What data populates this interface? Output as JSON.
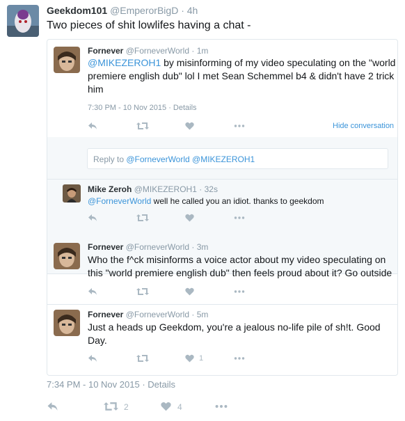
{
  "main_tweet": {
    "name": "Geekdom101",
    "handle": "@EmperorBigD",
    "time": "4h",
    "text": "Two pieces of shit lowlifes having a chat -",
    "footer": {
      "date": "7:34 PM - 10 Nov 2015",
      "details": "Details",
      "retweets": "2",
      "likes": "4"
    }
  },
  "thread": {
    "first": {
      "name": "Fornever",
      "handle": "@ForneverWorld",
      "time": "1m",
      "mention": "@MIKEZEROH1",
      "text_line1": "by misinforming of my video speculating on the \"world",
      "text_line2": "premiere english dub\" lol I met Sean Schemmel b4 & didn't have 2 trick",
      "text_line3": "him",
      "date": "7:30 PM - 10 Nov 2015",
      "details": "Details",
      "hide_conversation": "Hide conversation"
    },
    "reply_box": {
      "prefix": "Reply to",
      "mentions": "@ForneverWorld @MIKEZEROH1"
    },
    "second": {
      "name": "Mike Zeroh",
      "handle": "@MIKEZEROH1",
      "time": "32s",
      "mention": "@ForneverWorld",
      "text": "well he called you an idiot. thanks to geekdom"
    },
    "third": {
      "name": "Fornever",
      "handle": "@ForneverWorld",
      "time": "3m",
      "text_line1": "Who the f^ck misinforms a voice actor about my video speculating on",
      "text_line2": "this \"world premiere english dub\" then feels proud about it? Go outside"
    },
    "fourth": {
      "name": "Fornever",
      "handle": "@ForneverWorld",
      "time": "5m",
      "text_line1": "Just a heads up Geekdom, you're a jealous no-life pile of sh!t. Good",
      "text_line2": "Day.",
      "likes": "1"
    }
  },
  "colors": {
    "link": "#3b94d9",
    "muted": "#8899a6",
    "icon": "#aab8c2",
    "border": "#e1e8ed",
    "reply_bg": "#f5f8fa"
  },
  "icons": [
    "reply-icon",
    "retweet-icon",
    "heart-icon",
    "more-icon"
  ]
}
